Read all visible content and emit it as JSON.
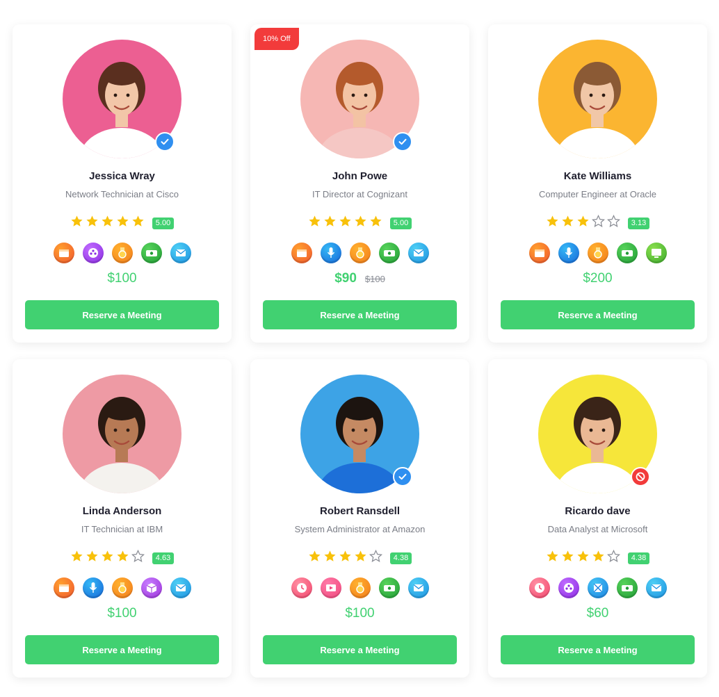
{
  "cards": [
    {
      "name": "Jessica Wray",
      "role": "Network Technician at Cisco",
      "score": "5.00",
      "stars": [
        1,
        1,
        1,
        1,
        1
      ],
      "icons": [
        "calendar-icon",
        "film-reel-icon",
        "medal-icon",
        "money-icon",
        "mail-icon"
      ],
      "price": "$100",
      "old_price": "",
      "discount": "",
      "status": "verified",
      "button": "Reserve a Meeting",
      "avatar_bg": "#ec5f92",
      "shirt": "#ffffff",
      "hair": "#5a2f1f",
      "skin": "#f2c6a8"
    },
    {
      "name": "John Powe",
      "role": "IT Director at Cognizant",
      "score": "5.00",
      "stars": [
        1,
        1,
        1,
        1,
        1
      ],
      "icons": [
        "calendar-icon",
        "mic-icon",
        "medal-icon",
        "money-icon",
        "mail-icon"
      ],
      "price": "$90",
      "old_price": "$100",
      "discount": "10% Off",
      "status": "verified",
      "button": "Reserve a Meeting",
      "avatar_bg": "#f6b7b4",
      "shirt": "#f5c7c4",
      "hair": "#b45a2c",
      "skin": "#f3c3a4"
    },
    {
      "name": "Kate Williams",
      "role": "Computer Engineer at Oracle",
      "score": "3.13",
      "stars": [
        1,
        1,
        1,
        0,
        0
      ],
      "icons": [
        "calendar-icon",
        "mic-icon",
        "medal-icon",
        "money-icon",
        "screen-icon"
      ],
      "price": "$200",
      "old_price": "",
      "discount": "",
      "status": "",
      "button": "Reserve a Meeting",
      "avatar_bg": "#fbb531",
      "shirt": "#ffffff",
      "hair": "#8b5a35",
      "skin": "#f1c7a7"
    },
    {
      "name": "Linda Anderson",
      "role": "IT Technician at IBM",
      "score": "4.63",
      "stars": [
        1,
        1,
        1,
        1,
        0
      ],
      "icons": [
        "calendar-icon",
        "mic-icon",
        "medal-icon",
        "cube-icon",
        "mail-icon"
      ],
      "price": "$100",
      "old_price": "",
      "discount": "",
      "status": "",
      "button": "Reserve a Meeting",
      "avatar_bg": "#ee9aa4",
      "shirt": "#f4f2ee",
      "hair": "#2a1a12",
      "skin": "#b77a55"
    },
    {
      "name": "Robert Ransdell",
      "role": "System Administrator at Amazon",
      "score": "4.38",
      "stars": [
        1,
        1,
        1,
        1,
        0
      ],
      "icons": [
        "clock-icon",
        "video-icon",
        "medal-icon",
        "money-icon",
        "mail-icon"
      ],
      "price": "$100",
      "old_price": "",
      "discount": "",
      "status": "verified",
      "button": "Reserve a Meeting",
      "avatar_bg": "#3da3e6",
      "shirt": "#1d6fd8",
      "hair": "#1c1410",
      "skin": "#c58a63"
    },
    {
      "name": "Ricardo dave",
      "role": "Data Analyst at Microsoft",
      "score": "4.38",
      "stars": [
        1,
        1,
        1,
        1,
        0
      ],
      "icons": [
        "clock-icon",
        "film-reel-icon",
        "box-icon",
        "money-icon",
        "mail-icon"
      ],
      "price": "$60",
      "old_price": "",
      "discount": "",
      "status": "blocked",
      "button": "Reserve a Meeting",
      "avatar_bg": "#f6e63a",
      "shirt": "#ffffff",
      "hair": "#3a2418",
      "skin": "#eab894"
    }
  ],
  "colors": {
    "accent": "#41d171",
    "star": "#f8c10a",
    "discount": "#f23b3b",
    "verified": "#2f8ff0"
  }
}
